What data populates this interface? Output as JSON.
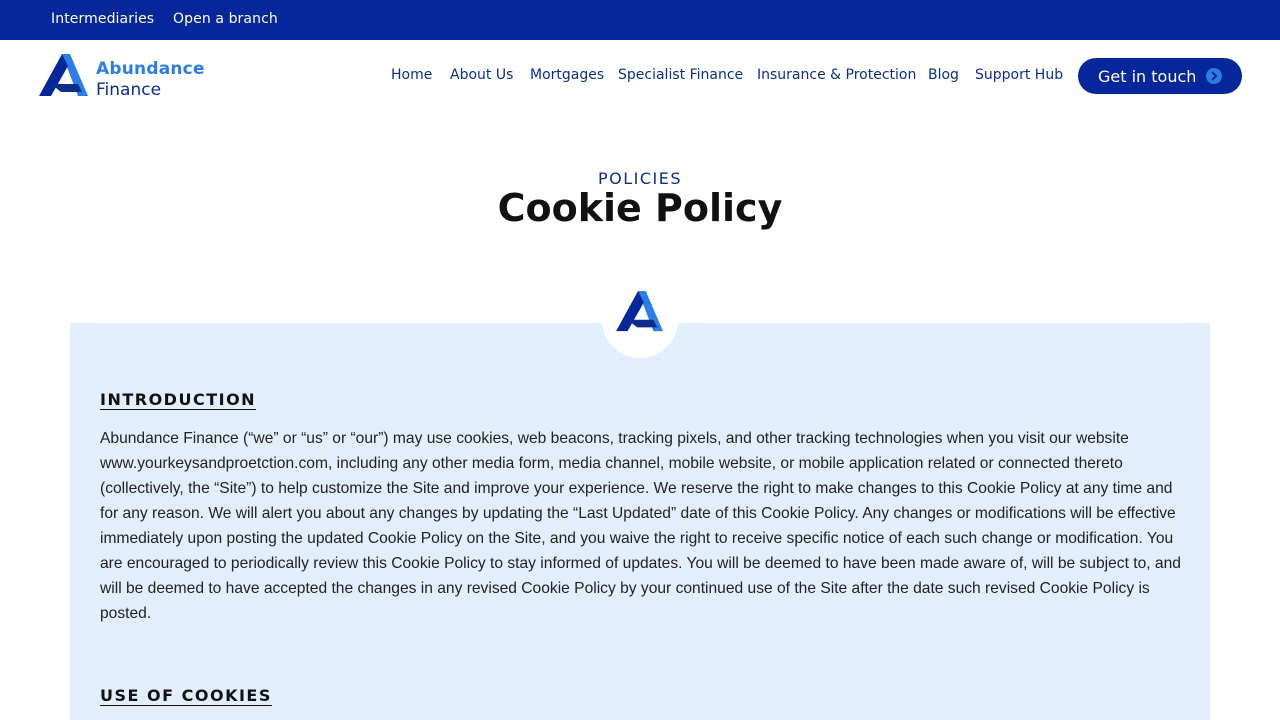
{
  "topbar": {
    "links": [
      "Intermediaries",
      "Open a branch"
    ]
  },
  "brand": {
    "line1": "Abundance",
    "line2": "Finance",
    "colors": {
      "primary": "#06279c",
      "accent": "#2a7ee6",
      "panel": "#e3eefc"
    }
  },
  "nav": {
    "items": [
      "Home",
      "About Us",
      "Mortgages",
      "Specialist Finance",
      "Insurance & Protection",
      "Blog",
      "Support Hub"
    ],
    "cta_label": "Get in touch",
    "cta_icon": "chevron-right-circle-icon"
  },
  "hero": {
    "kicker": "POLICIES",
    "title": "Cookie Policy"
  },
  "sections": [
    {
      "heading": "INTRODUCTION",
      "body": "Abundance Finance (“we” or “us” or “our”) may use cookies, web beacons, tracking pixels, and other tracking technologies when you visit our website www.yourkeysandproetction.com, including any other media form, media channel, mobile website, or mobile application related or connected thereto (collectively, the “Site”) to help customize the Site and improve your experience. We reserve the right to make changes to this Cookie Policy at any time and for any reason. We will alert you about any changes by updating the “Last Updated” date of this Cookie Policy. Any changes or modifications will be effective immediately upon posting the updated Cookie Policy on the Site, and you waive the right to receive specific notice of each such change or modification. You are encouraged to periodically review this Cookie Policy to stay informed of updates. You will be deemed to have been made aware of, will be subject to, and will be deemed to have accepted the changes in any revised Cookie Policy by your continued use of the Site after the date such revised Cookie Policy is posted."
    },
    {
      "heading": "USE OF COOKIES"
    }
  ]
}
